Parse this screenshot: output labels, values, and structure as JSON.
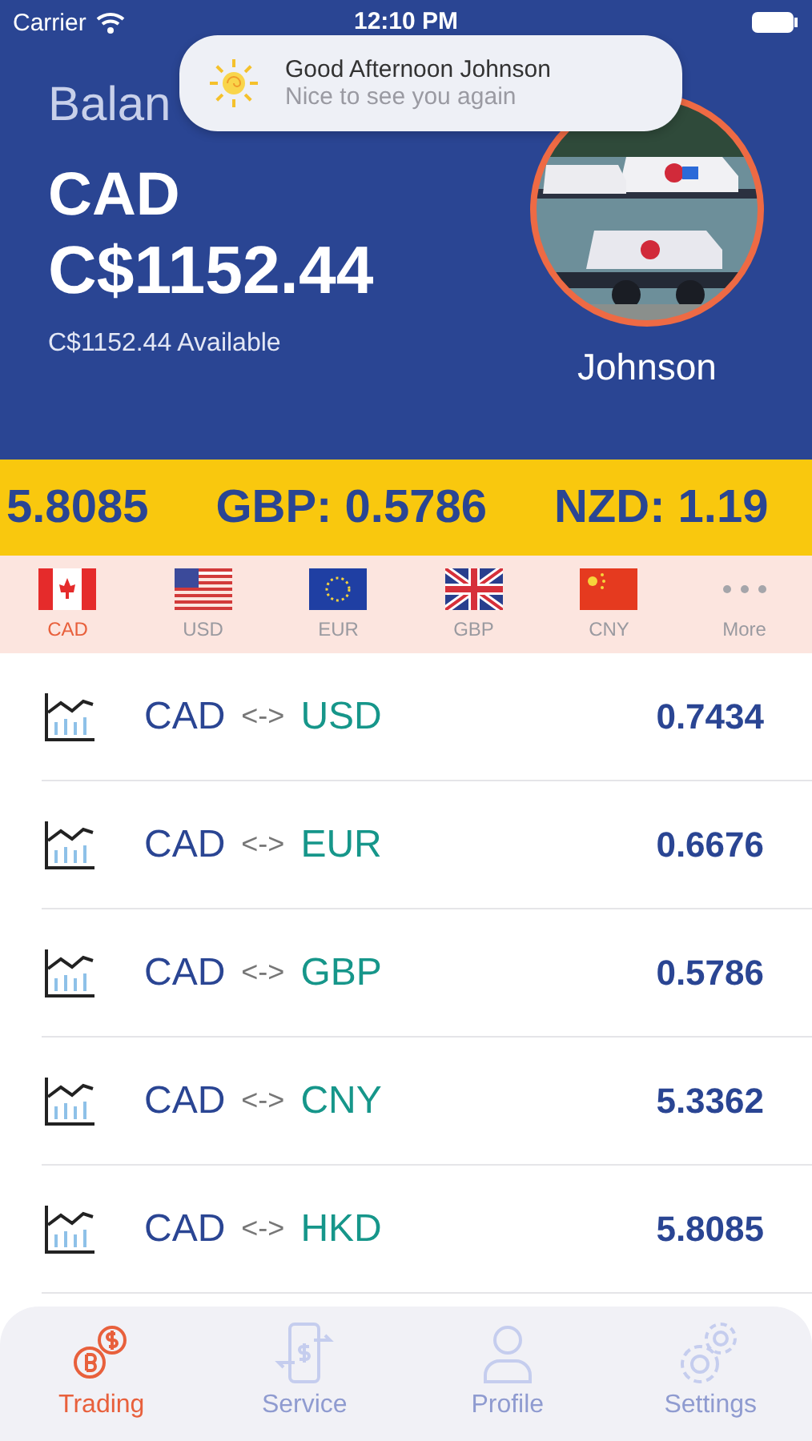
{
  "status_bar": {
    "carrier": "Carrier",
    "time": "12:10 PM"
  },
  "notification": {
    "title": "Good Afternoon Johnson",
    "message": "Nice to see you again"
  },
  "balance": {
    "label": "Balan",
    "currency": "CAD",
    "amount": "C$1152.44",
    "available": "C$1152.44 Available"
  },
  "profile": {
    "name": "Johnson"
  },
  "ticker": [
    "5.8085",
    "GBP: 0.5786",
    "NZD: 1.19"
  ],
  "currency_tabs": [
    {
      "label": "CAD",
      "kind": "ca",
      "selected": true
    },
    {
      "label": "USD",
      "kind": "us",
      "selected": false
    },
    {
      "label": "EUR",
      "kind": "eu",
      "selected": false
    },
    {
      "label": "GBP",
      "kind": "gb",
      "selected": false
    },
    {
      "label": "CNY",
      "kind": "cn",
      "selected": false
    },
    {
      "label": "More",
      "kind": "more",
      "selected": false
    }
  ],
  "rates": [
    {
      "base": "CAD",
      "separator": "<->",
      "quote": "USD",
      "rate": "0.7434"
    },
    {
      "base": "CAD",
      "separator": "<->",
      "quote": "EUR",
      "rate": "0.6676"
    },
    {
      "base": "CAD",
      "separator": "<->",
      "quote": "GBP",
      "rate": "0.5786"
    },
    {
      "base": "CAD",
      "separator": "<->",
      "quote": "CNY",
      "rate": "5.3362"
    },
    {
      "base": "CAD",
      "separator": "<->",
      "quote": "HKD",
      "rate": "5.8085"
    }
  ],
  "tab_bar": [
    {
      "label": "Trading",
      "kind": "trading",
      "selected": true
    },
    {
      "label": "Service",
      "kind": "service",
      "selected": false
    },
    {
      "label": "Profile",
      "kind": "profile",
      "selected": false
    },
    {
      "label": "Settings",
      "kind": "settings",
      "selected": false
    }
  ]
}
